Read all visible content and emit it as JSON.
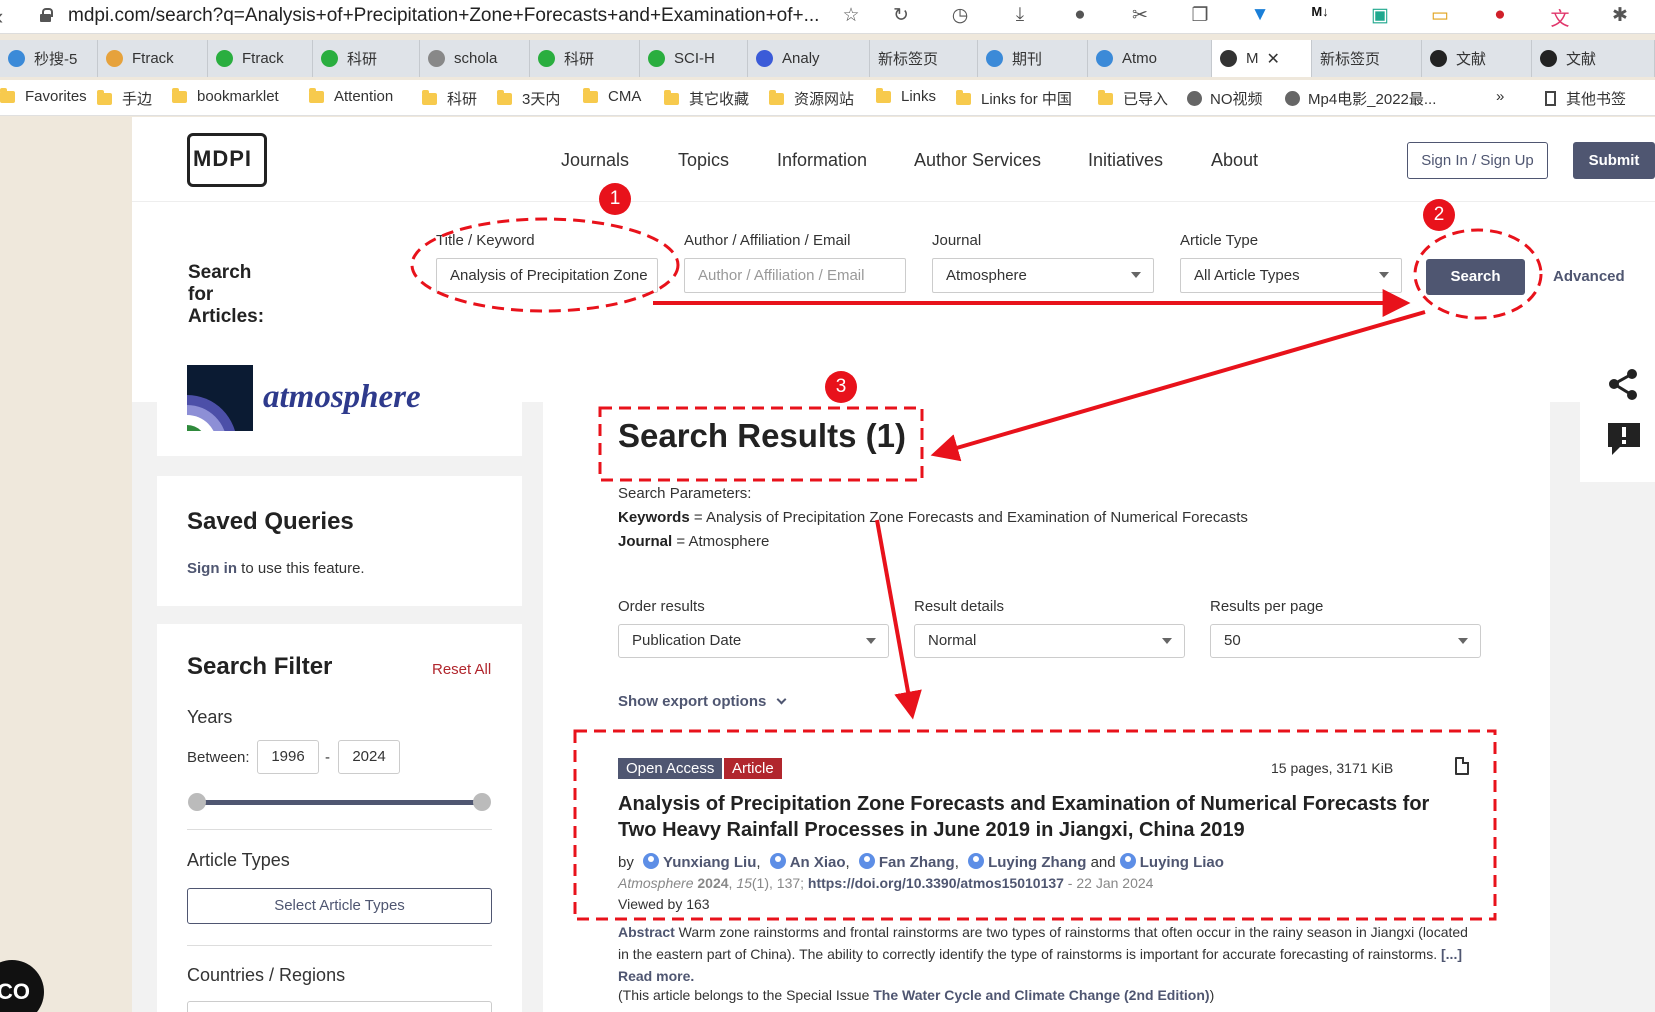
{
  "browser": {
    "url": "mdpi.com/search?q=Analysis+of+Precipitation+Zone+Forecasts+and+Examination+of+...",
    "tabs": [
      {
        "label": "秒搜-5",
        "color": "#3b8ad8"
      },
      {
        "label": "Ftrack",
        "color": "#e6a23c"
      },
      {
        "label": "Ftrack",
        "color": "#2aae3f"
      },
      {
        "label": "科研",
        "color": "#2aae3f"
      },
      {
        "label": "schola",
        "color": "#888888"
      },
      {
        "label": "科研",
        "color": "#2aae3f"
      },
      {
        "label": "SCI-H",
        "color": "#2aae3f"
      },
      {
        "label": "Analy",
        "color": "#3b5bd8"
      },
      {
        "label": "新标签页",
        "color": ""
      },
      {
        "label": "期刊",
        "color": "#3b8ad8"
      },
      {
        "label": "Atmo",
        "color": "#3b8ad8"
      },
      {
        "label": "M",
        "color": "#333333"
      },
      {
        "label": "新标签页",
        "color": ""
      },
      {
        "label": "文献",
        "color": "#222222"
      },
      {
        "label": "文献",
        "color": "#222222"
      }
    ],
    "bookmarks": [
      {
        "label": "Favorites",
        "icon": "folder"
      },
      {
        "label": "手边",
        "icon": "folder"
      },
      {
        "label": "bookmarklet",
        "icon": "folder"
      },
      {
        "label": "Attention",
        "icon": "folder"
      },
      {
        "label": "科研",
        "icon": "folder"
      },
      {
        "label": "3天内",
        "icon": "folder"
      },
      {
        "label": "CMA",
        "icon": "folder"
      },
      {
        "label": "其它收藏",
        "icon": "folder"
      },
      {
        "label": "资源网站",
        "icon": "folder"
      },
      {
        "label": "Links",
        "icon": "folder"
      },
      {
        "label": "Links for 中国",
        "icon": "folder"
      },
      {
        "label": "已导入",
        "icon": "folder"
      },
      {
        "label": "NO视频",
        "icon": "globe"
      },
      {
        "label": "Mp4电影_2022最...",
        "icon": "globe"
      }
    ],
    "more_bookmarks": "»",
    "other_bookmarks": "其他书签"
  },
  "nav": {
    "logo": "MDPI",
    "links": [
      "Journals",
      "Topics",
      "Information",
      "Author Services",
      "Initiatives",
      "About"
    ],
    "signin": "Sign In / Sign Up",
    "submit": "Submit"
  },
  "search": {
    "heading": "Search for Articles:",
    "title_label": "Title / Keyword",
    "title_value": "Analysis of Precipitation Zone",
    "author_label": "Author / Affiliation / Email",
    "author_placeholder": "Author / Affiliation / Email",
    "journal_label": "Journal",
    "journal_value": "Atmosphere",
    "type_label": "Article Type",
    "type_value": "All Article Types",
    "button": "Search",
    "advanced": "Advanced"
  },
  "sidebar": {
    "journal_name": "atmosphere",
    "saved_title": "Saved Queries",
    "saved_signin": "Sign in",
    "saved_text": "to use this feature.",
    "filter_title": "Search Filter",
    "reset": "Reset All",
    "years_label": "Years",
    "between": "Between:",
    "year_from": "1996",
    "year_to": "2024",
    "year_dash": "-",
    "article_types": "Article Types",
    "select_types": "Select Article Types",
    "countries": "Countries / Regions"
  },
  "results": {
    "title": "Search Results (1)",
    "params_label": "Search Parameters:",
    "keywords_label": "Keywords",
    "keywords_value": " = Analysis of Precipitation Zone Forecasts and Examination of Numerical Forecasts",
    "journal_label": "Journal",
    "journal_value": " = Atmosphere",
    "order_label": "Order results",
    "order_value": "Publication Date",
    "details_label": "Result details",
    "details_value": "Normal",
    "perpage_label": "Results per page",
    "perpage_value": "50",
    "export": "Show export options"
  },
  "article": {
    "badge_oa": "Open Access",
    "badge_type": "Article",
    "pages": "15 pages, 3171 KiB",
    "title": "Analysis of Precipitation Zone Forecasts and Examination of Numerical Forecasts for Two Heavy Rainfall Processes in June 2019 in Jiangxi, China 2019",
    "by": "by",
    "authors": [
      "Yunxiang Liu",
      "An Xiao",
      "Fan Zhang",
      "Luying Zhang",
      "Luying Liao"
    ],
    "sep_comma": ",",
    "sep_and": "and",
    "journal": "Atmosphere",
    "year": "2024",
    "volume": "15",
    "issue_page": "(1), 137; ",
    "doi": "https://doi.org/10.3390/atmos15010137",
    "date": " - 22 Jan 2024",
    "viewed": "Viewed by 163",
    "abstract_label": "Abstract",
    "abstract": " Warm zone rainstorms and frontal rainstorms are two types of rainstorms that often occur in the rainy season in Jiangxi (located in the eastern part of China). The ability to correctly identify the type of rainstorms is important for accurate forecasting of rainstorms. ",
    "read_more": "[...] Read more.",
    "special_prefix": "(This article belongs to the Special Issue ",
    "special_issue": "The Water Cycle and Climate Change (2nd Edition)",
    "special_suffix": ")"
  },
  "annotations": {
    "step1": "1",
    "step2": "2",
    "step3": "3",
    "color": "#e8121b"
  },
  "chat_bubble": "CO"
}
